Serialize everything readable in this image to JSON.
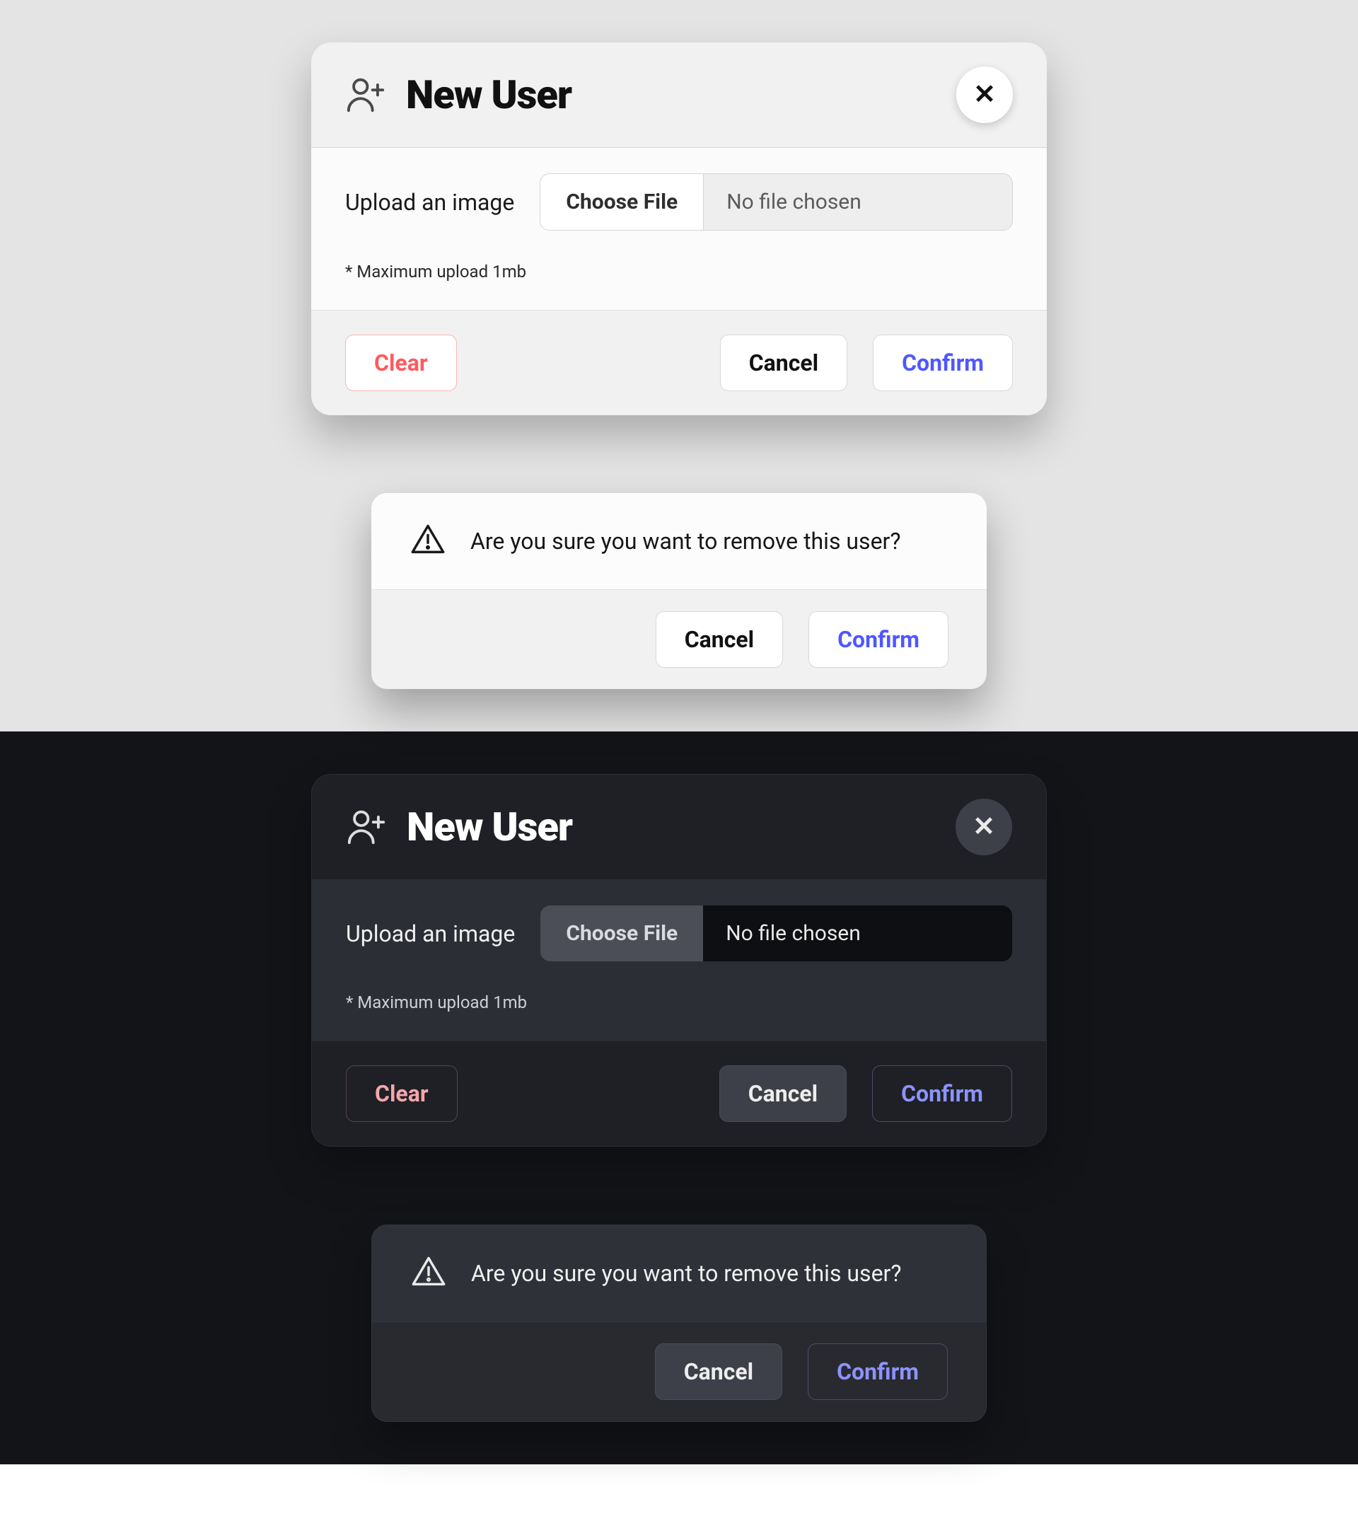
{
  "new_user": {
    "title": "New User",
    "upload_label": "Upload an image",
    "choose_file": "Choose File",
    "file_name": "No file chosen",
    "hint": "* Maximum upload 1mb",
    "clear": "Clear",
    "cancel": "Cancel",
    "confirm": "Confirm"
  },
  "remove_dialog": {
    "message": "Are you sure you want to remove this user?",
    "cancel": "Cancel",
    "confirm": "Confirm"
  },
  "colors": {
    "accent_blue": "#4f57ff",
    "accent_blue_dark": "#8c93ff",
    "danger": "#ff5a5f",
    "danger_dark": "#f4a6ac"
  }
}
